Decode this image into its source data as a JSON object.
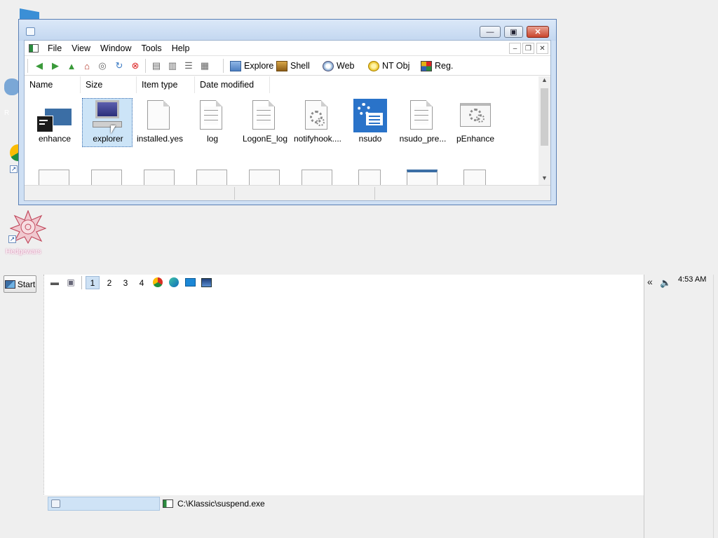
{
  "desktop": {
    "icons": [
      {
        "name": "blue-folder-icon"
      },
      {
        "name": "recycle-icon",
        "label": "R"
      },
      {
        "name": "chrome-icon"
      },
      {
        "name": "hedgewars-icon",
        "label": "Hedgewars"
      }
    ]
  },
  "window": {
    "title": "",
    "menu": [
      "File",
      "View",
      "Window",
      "Tools",
      "Help"
    ],
    "toolbar_labels": {
      "explore": "Explore",
      "shell": "Shell",
      "web": "Web",
      "ntobj": "NT Obj",
      "reg": "Reg."
    },
    "columns": [
      "Name",
      "Size",
      "Item type",
      "Date modified"
    ],
    "items": [
      {
        "label": "enhance",
        "icon": "app-window-icon"
      },
      {
        "label": "explorer",
        "icon": "computer-icon",
        "selected": true
      },
      {
        "label": "installed.yes",
        "icon": "blank-file-icon"
      },
      {
        "label": "log",
        "icon": "text-file-icon"
      },
      {
        "label": "LogonE_log",
        "icon": "text-file-icon"
      },
      {
        "label": "notifyhook....",
        "icon": "settings-file-icon"
      },
      {
        "label": "nsudo",
        "icon": "nsudo-icon"
      },
      {
        "label": "nsudo_pre...",
        "icon": "text-file-icon"
      },
      {
        "label": "pEnhance",
        "icon": "settings-window-icon"
      }
    ]
  },
  "taskbar": {
    "start_label": "Start",
    "desktops": [
      "1",
      "2",
      "3",
      "4"
    ],
    "active_desktop": "1",
    "clock": "4:53 AM",
    "task_text": "C:\\Klassic\\suspend.exe"
  },
  "colors": {
    "accent": "#cce4f7",
    "titlebar": "#cfe0f4",
    "close": "#c9442c"
  }
}
